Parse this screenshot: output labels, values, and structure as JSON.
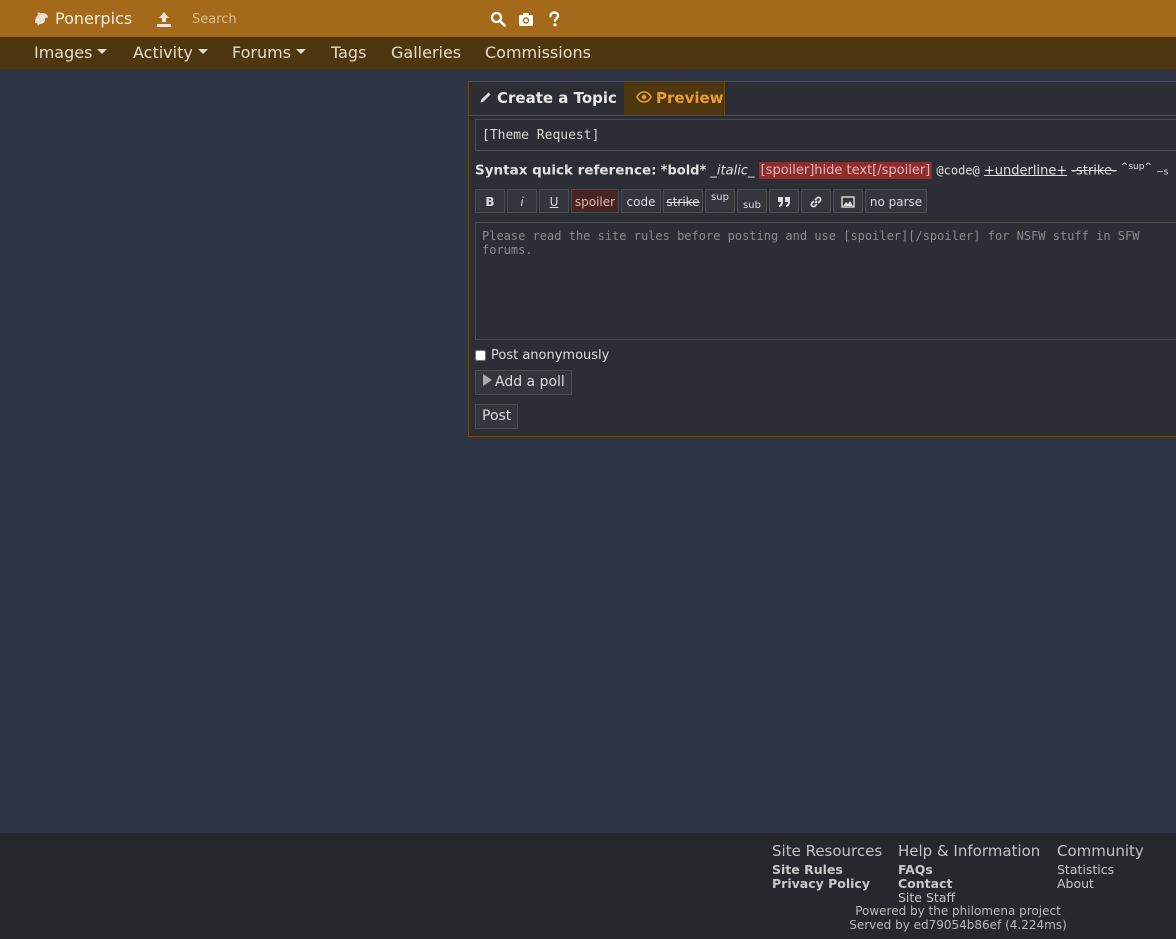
{
  "header": {
    "site_name": "Ponerpics",
    "search_placeholder": "Search",
    "icons": [
      "logo-icon",
      "upload-icon",
      "search-icon",
      "camera-icon",
      "help-icon"
    ],
    "accent_color": "#a46a19"
  },
  "nav": {
    "images": "Images",
    "activity": "Activity",
    "forums": "Forums",
    "tags": "Tags",
    "galleries": "Galleries",
    "commissions": "Commissions"
  },
  "topic": {
    "tab_create": "Create a Topic",
    "tab_preview": "Preview",
    "title_value": "[Theme Request]",
    "syntax": {
      "label": "Syntax quick reference:",
      "bold": "*bold*",
      "italic": "_italic_",
      "spoiler": "[spoiler]hide text[/spoiler]",
      "code": "@code@",
      "underline": "+underline+",
      "strike": "-strike-",
      "sup": "^sup^",
      "sub": "~s"
    },
    "toolbar": {
      "bold": "B",
      "italic": "i",
      "underline": "U",
      "spoiler": "spoiler",
      "code": "code",
      "strike": "strike",
      "sup": "sup",
      "sub": "sub",
      "no_parse": "no parse"
    },
    "body_placeholder": "Please read the site rules before posting and use [spoiler][/spoiler] for NSFW stuff in SFW forums.",
    "anonymous_label": "Post anonymously",
    "add_poll": "Add a poll",
    "post": "Post"
  },
  "footer": {
    "site_resources": {
      "title": "Site Resources",
      "links": [
        "Site Rules",
        "Privacy Policy"
      ]
    },
    "help": {
      "title": "Help & Information",
      "links": [
        "FAQs",
        "Contact",
        "Site Staff"
      ]
    },
    "community": {
      "title": "Community",
      "links": [
        "Statistics",
        "About"
      ]
    },
    "powered": "Powered by the philomena project",
    "served": "Served by ed79054b86ef (4.224ms)"
  }
}
